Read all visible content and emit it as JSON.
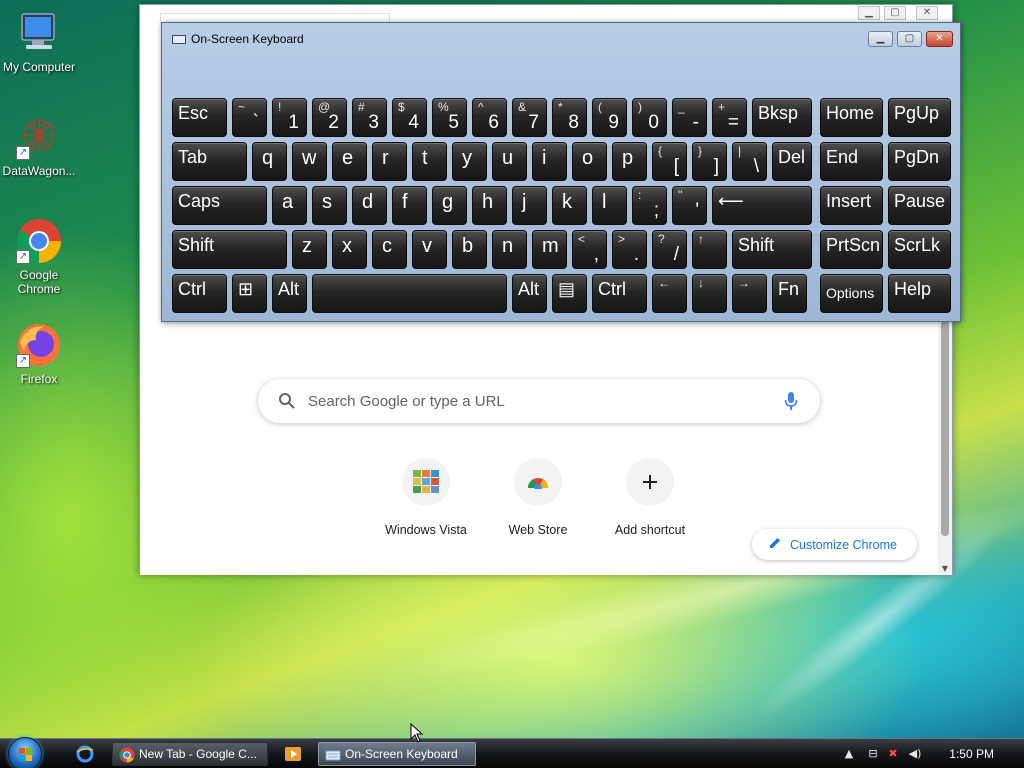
{
  "desktop": {
    "icons": [
      {
        "label": "My Computer",
        "icon": "computer-icon"
      },
      {
        "label": "DataWagon...",
        "icon": "datawagon-icon"
      },
      {
        "label": "Google Chrome",
        "icon": "chrome-icon"
      },
      {
        "label": "Firefox",
        "icon": "firefox-icon"
      }
    ]
  },
  "osk": {
    "title": "On-Screen Keyboard",
    "rows": [
      [
        {
          "label": "Esc"
        },
        {
          "shift": "~",
          "main": "`"
        },
        {
          "shift": "!",
          "main": "1"
        },
        {
          "shift": "@",
          "main": "2"
        },
        {
          "shift": "#",
          "main": "3"
        },
        {
          "shift": "$",
          "main": "4"
        },
        {
          "shift": "%",
          "main": "5"
        },
        {
          "shift": "^",
          "main": "6"
        },
        {
          "shift": "&",
          "main": "7"
        },
        {
          "shift": "*",
          "main": "8"
        },
        {
          "shift": "(",
          "main": "9"
        },
        {
          "shift": ")",
          "main": "0"
        },
        {
          "shift": "_",
          "main": "-"
        },
        {
          "shift": "+",
          "main": "="
        },
        {
          "label": "Bksp"
        },
        {
          "label": "Home"
        },
        {
          "label": "PgUp"
        }
      ],
      [
        {
          "label": "Tab"
        },
        {
          "label": "q"
        },
        {
          "label": "w"
        },
        {
          "label": "e"
        },
        {
          "label": "r"
        },
        {
          "label": "t"
        },
        {
          "label": "y"
        },
        {
          "label": "u"
        },
        {
          "label": "i"
        },
        {
          "label": "o"
        },
        {
          "label": "p"
        },
        {
          "shift": "{",
          "main": "["
        },
        {
          "shift": "}",
          "main": "]"
        },
        {
          "shift": "|",
          "main": "\\"
        },
        {
          "label": "Del"
        },
        {
          "label": "End"
        },
        {
          "label": "PgDn"
        }
      ],
      [
        {
          "label": "Caps"
        },
        {
          "label": "a"
        },
        {
          "label": "s"
        },
        {
          "label": "d"
        },
        {
          "label": "f"
        },
        {
          "label": "g"
        },
        {
          "label": "h"
        },
        {
          "label": "j"
        },
        {
          "label": "k"
        },
        {
          "label": "l"
        },
        {
          "shift": ":",
          "main": ";"
        },
        {
          "shift": "\"",
          "main": "'"
        },
        {
          "label": "⟵"
        },
        {
          "label": "Insert"
        },
        {
          "label": "Pause"
        }
      ],
      [
        {
          "label": "Shift"
        },
        {
          "label": "z"
        },
        {
          "label": "x"
        },
        {
          "label": "c"
        },
        {
          "label": "v"
        },
        {
          "label": "b"
        },
        {
          "label": "n"
        },
        {
          "label": "m"
        },
        {
          "shift": "<",
          "main": ","
        },
        {
          "shift": ">",
          "main": "."
        },
        {
          "shift": "?",
          "main": "/"
        },
        {
          "shift": "↑",
          "main": ""
        },
        {
          "label": "Shift"
        },
        {
          "label": "PrtScn"
        },
        {
          "label": "ScrLk"
        }
      ],
      [
        {
          "label": "Ctrl"
        },
        {
          "label": "⊞"
        },
        {
          "label": "Alt"
        },
        {
          "label": ""
        },
        {
          "label": "Alt"
        },
        {
          "label": "▤"
        },
        {
          "label": "Ctrl"
        },
        {
          "shift": "←",
          "main": ""
        },
        {
          "shift": "↓",
          "main": ""
        },
        {
          "shift": "→",
          "main": ""
        },
        {
          "label": "Fn"
        },
        {
          "label": "Options"
        },
        {
          "label": "Help"
        }
      ]
    ]
  },
  "chrome": {
    "search_placeholder": "Search Google or type a URL",
    "shortcuts": [
      {
        "label": "Windows Vista",
        "icon": "windows-vista-tile-icon"
      },
      {
        "label": "Web Store",
        "icon": "web-store-icon"
      },
      {
        "label": "Add shortcut",
        "icon": "plus-icon"
      }
    ],
    "customize_label": "Customize Chrome"
  },
  "taskbar": {
    "buttons": [
      {
        "label": "New Tab - Google C...",
        "icon": "chrome-icon"
      },
      {
        "label": "On-Screen Keyboard",
        "icon": "keyboard-icon"
      }
    ],
    "clock": "1:50 PM"
  }
}
